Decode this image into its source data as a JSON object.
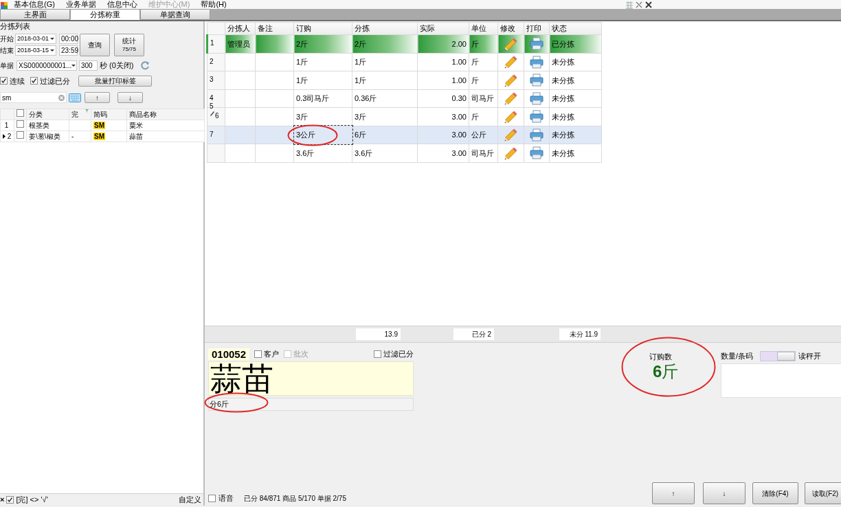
{
  "menu": [
    {
      "label": "基本信息(G)",
      "disabled": false
    },
    {
      "label": "业务单据",
      "disabled": false
    },
    {
      "label": "信息中心",
      "disabled": false
    },
    {
      "label": "维护中心(M)",
      "disabled": true
    },
    {
      "label": "帮助(H)",
      "disabled": false
    }
  ],
  "tabs": [
    {
      "label": "主界面",
      "selected": false
    },
    {
      "label": "分拣称重",
      "selected": true
    },
    {
      "label": "单据查询",
      "selected": false
    }
  ],
  "left_panel": {
    "title": "分拣列表",
    "start": {
      "label": "开始",
      "date": "2018-03-01",
      "time": "00:00"
    },
    "end": {
      "label": "结束",
      "date": "2018-03-15",
      "time": "23:59"
    },
    "query_button": "查询",
    "stats_button": {
      "label": "统计",
      "count": "75/75"
    },
    "order": {
      "label": "单据",
      "value": "XS0000000001...",
      "interval": "300",
      "interval_unit": "秒 (0关闭)"
    },
    "options": [
      {
        "label": "连续",
        "checked": true
      },
      {
        "label": "过滤已分",
        "checked": true
      }
    ],
    "batch_print_button": "批量打印标签",
    "search": {
      "value": "sm"
    },
    "up_button": "↑",
    "down_button": "↓",
    "list": {
      "select_all": false,
      "columns": [
        "分类",
        "完",
        "简码",
        "商品名称"
      ],
      "rows": [
        {
          "index": "1",
          "current": false,
          "checked": false,
          "category": "根茎类",
          "code": "SM",
          "name": "粟米"
        },
        {
          "index": "2",
          "current": true,
          "checked": false,
          "category": "姜\\葱\\椒类",
          "done": "-",
          "code": "SM",
          "name": "蒜苗"
        }
      ]
    },
    "filter_bar": {
      "clear": "×",
      "enabled": true,
      "expression": "[完] <> '√'",
      "customize": "自定义"
    }
  },
  "grid": {
    "columns": [
      "分拣人",
      "备注",
      "订购",
      "分拣",
      "实际",
      "单位",
      "修改",
      "打印",
      "状态"
    ],
    "rows": [
      {
        "index": "1",
        "sorter": "管理员",
        "order": "2斤",
        "sorted": "2斤",
        "actual": "2.00",
        "unit": "斤",
        "status": "已分拣",
        "done": true,
        "selected": false,
        "editing": false,
        "highlight": false
      },
      {
        "index": "2",
        "order": "1斤",
        "sorted": "1斤",
        "actual": "1.00",
        "unit": "斤",
        "status": "未分拣",
        "done": false,
        "selected": false,
        "editing": false,
        "highlight": false
      },
      {
        "index": "3",
        "order": "1斤",
        "sorted": "1斤",
        "actual": "1.00",
        "unit": "斤",
        "status": "未分拣",
        "done": false,
        "selected": false,
        "editing": false,
        "highlight": false
      },
      {
        "index": "4",
        "order": "0.3司马斤",
        "sorted": "0.36斤",
        "actual": "0.30",
        "unit": "司马斤",
        "status": "未分拣",
        "done": false,
        "selected": false,
        "editing": false,
        "highlight": false
      },
      {
        "index": "6",
        "order": "3斤",
        "sorted": "3斤",
        "actual": "3.00",
        "unit": "斤",
        "status": "未分拣",
        "done": false,
        "selected": false,
        "editing": true,
        "highlight": false
      },
      {
        "index": "7",
        "order": "3公斤",
        "sorted": "6斤",
        "actual": "3.00",
        "unit": "公斤",
        "status": "未分拣",
        "done": false,
        "selected": true,
        "editing": false,
        "highlight": true
      },
      {
        "index": "",
        "order": "3.6斤",
        "sorted": "3.6斤",
        "actual": "3.00",
        "unit": "司马斤",
        "status": "未分拣",
        "done": false,
        "selected": false,
        "editing": false,
        "highlight": false
      }
    ],
    "row_numbers_between": [
      "5"
    ]
  },
  "summary": [
    "13.9",
    "已分 2",
    "未分 11.9"
  ],
  "detail": {
    "code": "010052",
    "options": [
      {
        "label": "客户",
        "checked": false,
        "disabled": false
      },
      {
        "label": "批次",
        "checked": false,
        "disabled": true
      }
    ],
    "filter_sorted": {
      "label": "过滤已分",
      "checked": false
    },
    "product_name": "蒜苗",
    "remark": "分6斤",
    "remark_highlight": true,
    "voice": {
      "label": "语音",
      "checked": false
    },
    "progress": "已分 84/871 商品 5/170 单据 2/75"
  },
  "order_count": {
    "label": "订购数",
    "amount": "6",
    "unit": "斤",
    "highlight": true
  },
  "scale": {
    "label": "数量/条码",
    "toggle_label": "读秤开",
    "on": false
  },
  "buttons": [
    {
      "label": "↑"
    },
    {
      "label": "↓"
    },
    {
      "label": "清除(F4)"
    },
    {
      "label": "读取(F2)"
    }
  ]
}
